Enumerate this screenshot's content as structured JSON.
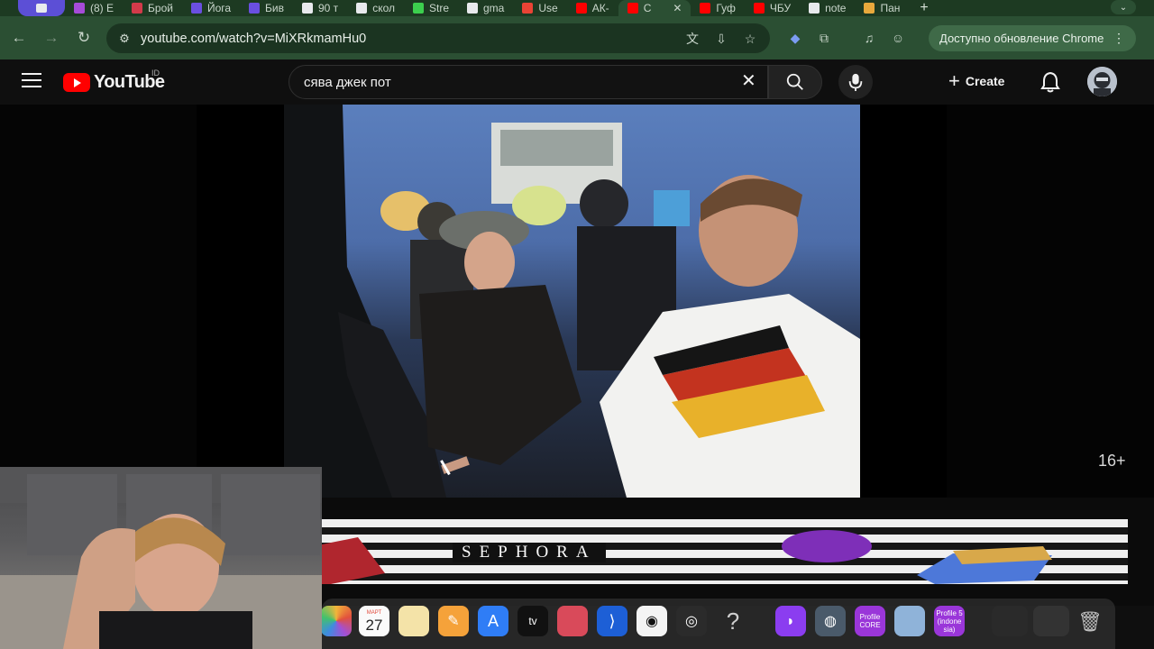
{
  "browser": {
    "tabs": [
      {
        "label": "(8) E",
        "color": "#a64bd8"
      },
      {
        "label": "Брой",
        "color": "#d33a4a"
      },
      {
        "label": "Йога",
        "color": "#6a4fe0"
      },
      {
        "label": "Бив",
        "color": "#6a4fe0"
      },
      {
        "label": "90 т",
        "color": "#e8eaed"
      },
      {
        "label": "скол",
        "color": "#e8eaed"
      },
      {
        "label": "Stre",
        "color": "#3ccf4e"
      },
      {
        "label": "gma",
        "color": "#e8eaed"
      },
      {
        "label": "Use",
        "color": "#ea4335"
      },
      {
        "label": "АК-",
        "color": "#ff0000"
      },
      {
        "label": "С",
        "color": "#ff0000"
      },
      {
        "label": "Гуф",
        "color": "#ff0000"
      },
      {
        "label": "ЧБУ",
        "color": "#ff0000"
      },
      {
        "label": "note",
        "color": "#e8eaed"
      },
      {
        "label": "Пан",
        "color": "#e8a93c"
      }
    ],
    "new_tab_label": "+",
    "url": "youtube.com/watch?v=MiXRkmamHu0",
    "update_label": "Доступно обновление Chrome"
  },
  "youtube": {
    "logo_text": "YouTube",
    "region": "ID",
    "search_query": "сява джек пот",
    "create_label": "Create",
    "age_rating": "16+"
  },
  "banner": {
    "brand": "SEPHORA"
  },
  "dock": {
    "calendar_month": "МАРТ",
    "calendar_day": "27",
    "apple_tv_label": "tv",
    "question_label": "?",
    "profile_core": "Profile CORE",
    "profile_5": "Profile 5 (indone sia)"
  },
  "icons": {
    "back": "arrow-left",
    "forward": "arrow-right",
    "reload": "reload",
    "search": "search",
    "mic": "microphone",
    "bell": "bell"
  }
}
